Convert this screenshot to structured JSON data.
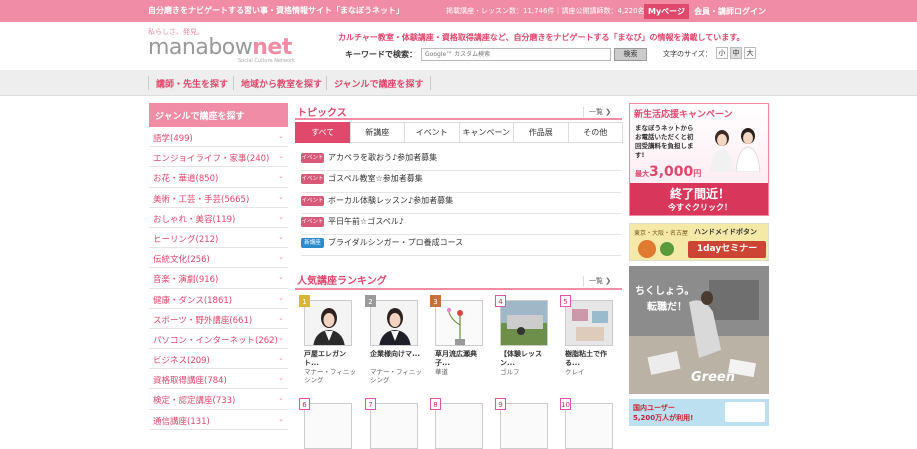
{
  "header": {
    "tagline": "自分磨きをナビゲートする習い事・資格情報サイト「まなぼうネット」",
    "stats": "掲載講座・レッスン数：11,746件｜講座公開講師数：4,220名",
    "mypage_label": "Myページ",
    "login_label": "会員・講師ログイン",
    "logo_small": "私らしさ、発見。",
    "logo_text_a": "manabow",
    "logo_text_b": "net",
    "logo_sub": "Social Culture Network",
    "intro": "カルチャー教室・体験講座・資格取得講座など、自分磨きをナビゲートする「まなび」の情報を満載しています。",
    "keyword_label": "キーワードで検索：",
    "search_placeholder": "Google™ カスタム検索",
    "search_button": "検索",
    "fontsize_label": "文字のサイズ：",
    "fontsize_options": [
      "小",
      "中",
      "大"
    ]
  },
  "nav": {
    "items": [
      "講師・先生を探す",
      "地域から教室を探す",
      "ジャンルで講座を探す"
    ]
  },
  "sidebar": {
    "title": "ジャンルで講座を探す",
    "categories": [
      "語学(499)",
      "エンジョイライフ・家事(240)",
      "お花・華道(850)",
      "美術・工芸・手芸(5665)",
      "おしゃれ・美容(119)",
      "ヒーリング(212)",
      "伝統文化(256)",
      "音楽・演劇(916)",
      "健康・ダンス(1861)",
      "スポーツ・野外講座(661)",
      "パソコン・インターネット(262)",
      "ビジネス(209)",
      "資格取得講座(784)",
      "検定・認定講座(733)",
      "通信講座(131)"
    ]
  },
  "topics": {
    "title": "トピックス",
    "more": "一覧",
    "tabs": [
      "すべて",
      "新講座",
      "イベント",
      "キャンペーン",
      "作品展",
      "その他"
    ],
    "items": [
      {
        "badge": "イベント",
        "type": "event",
        "text": "アカペラを歌おう♪参加者募集"
      },
      {
        "badge": "イベント",
        "type": "event",
        "text": "ゴスペル教室☆参加者募集"
      },
      {
        "badge": "イベント",
        "type": "event",
        "text": "ボーカル体験レッスン♪参加者募集"
      },
      {
        "badge": "イベント",
        "type": "event",
        "text": "平日午前☆ゴスペル♪"
      },
      {
        "badge": "新講座",
        "type": "new",
        "text": "ブライダルシンガー・プロ養成コース"
      }
    ]
  },
  "ranking": {
    "title": "人気講座ランキング",
    "more": "一覧",
    "items": [
      {
        "rank": "1",
        "title": "戸屋エレガント...",
        "category": "マナー・フィニッシング"
      },
      {
        "rank": "2",
        "title": "企業様向けマ...",
        "category": "マナー・フィニッシング"
      },
      {
        "rank": "3",
        "title": "草月流広瀬典子...",
        "category": "華道"
      },
      {
        "rank": "4",
        "title": "【体験レッスン...",
        "category": "ゴルフ"
      },
      {
        "rank": "5",
        "title": "樹脂粘土で作る...",
        "category": "クレイ"
      },
      {
        "rank": "6",
        "title": "",
        "category": ""
      },
      {
        "rank": "7",
        "title": "",
        "category": ""
      },
      {
        "rank": "8",
        "title": "",
        "category": ""
      },
      {
        "rank": "9",
        "title": "",
        "category": ""
      },
      {
        "rank": "10",
        "title": "",
        "category": ""
      }
    ]
  },
  "ads": {
    "ad1_title": "新生活応援キャンペーン",
    "ad1_body": "まなぼうネットからお電話いただくと初回受講料を負担します!",
    "ad1_max": "最大",
    "ad1_amount": "3,000",
    "ad1_yen": "円",
    "ad1_cta1": "終了間近！",
    "ad1_cta2": "今すぐクリック！",
    "ad2_places": "東京・大阪・名古屋",
    "ad2_text": "ハンドメイドボタン",
    "ad2_badge": "1dayセミナー",
    "ad3_text1": "ちくしょう。",
    "ad3_text2": "転職だ！",
    "ad3_logo": "Green",
    "ad4_text1": "国内ユーザー",
    "ad4_text2": "5,200万人が利用!"
  }
}
